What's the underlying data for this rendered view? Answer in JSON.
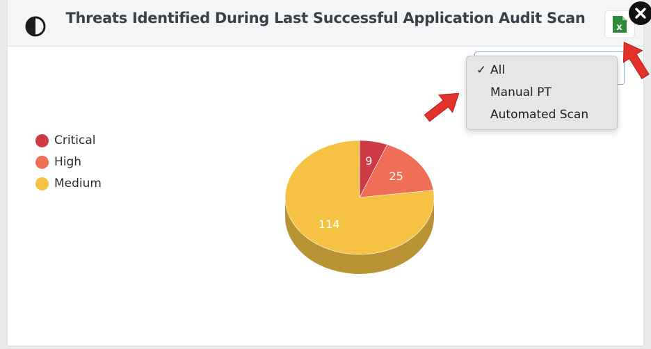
{
  "header": {
    "title": "Threats Identified During Last Successful Application Audit Scan",
    "theme_icon": "contrast-icon",
    "export_icon": "excel-icon",
    "export_letter": "x",
    "close_icon": "close-icon"
  },
  "filter": {
    "selected": "All",
    "options": [
      {
        "label": "All",
        "checked": true
      },
      {
        "label": "Manual PT",
        "checked": false
      },
      {
        "label": "Automated Scan",
        "checked": false
      }
    ]
  },
  "chart_data": {
    "type": "pie",
    "categories": [
      "Critical",
      "High",
      "Medium"
    ],
    "values": [
      9,
      25,
      114
    ],
    "colors": [
      "#cf3a47",
      "#ef6f56",
      "#f5c244"
    ],
    "legend": "left",
    "style": "3d"
  }
}
